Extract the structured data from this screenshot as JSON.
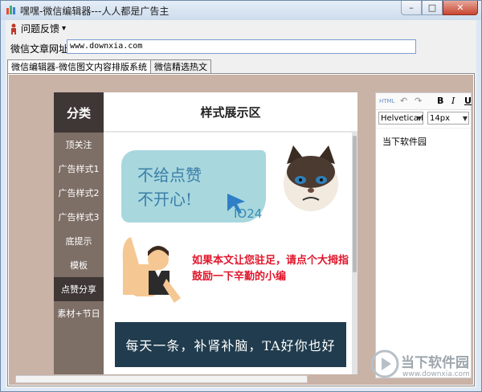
{
  "window": {
    "title": "嘿嘿-微信编辑器---人人都是广告主",
    "minimize": "–",
    "maximize": "□",
    "close": "✕"
  },
  "menu": {
    "feedback": "问题反馈",
    "dropdown_arrow": "▾"
  },
  "url": {
    "label": "微信文章网址:",
    "value": "www.downxia.com"
  },
  "tabs": [
    {
      "label": "微信编辑器-微信图文内容排版系统",
      "active": true
    },
    {
      "label": "微信精选热文",
      "active": false
    }
  ],
  "sidebar": {
    "header": "分类",
    "items": [
      {
        "label": "顶关注",
        "active": false
      },
      {
        "label": "广告样式1",
        "active": false
      },
      {
        "label": "广告样式2",
        "active": false
      },
      {
        "label": "广告样式3",
        "active": false
      },
      {
        "label": "底提示",
        "active": false
      },
      {
        "label": "模板",
        "active": false
      },
      {
        "label": "点赞分享",
        "active": true
      },
      {
        "label": "素材+节日",
        "active": false
      }
    ]
  },
  "display": {
    "title": "样式展示区",
    "ad1_line1": "不给点赞",
    "ad1_line2": "不开心!",
    "ad1_logo": "IO24",
    "ad2_text": "如果本文让您驻足，请点个大拇指鼓励一下辛勤的小编",
    "ad3_text": "每天一条，补肾补脑，TA好你也好"
  },
  "editor": {
    "html_btn": "HTML",
    "undo_icon": "↶",
    "redo_icon": "↷",
    "bold": "B",
    "italic": "I",
    "underline": "U",
    "font": "Helvetica N",
    "size": "14px",
    "content": "当下软件园"
  },
  "watermark": {
    "brand": "当下软件园",
    "url": "www.downxia.com"
  },
  "colors": {
    "sidebar_bg": "#7d6e66",
    "sidebar_active": "#3f3735",
    "canvas_bg": "#c9b2a6",
    "highlight_red": "#e0162b"
  }
}
